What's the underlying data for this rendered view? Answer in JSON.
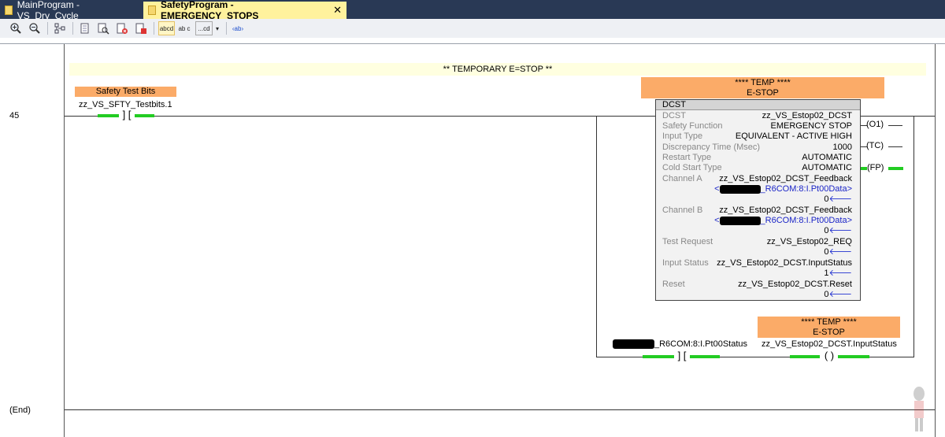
{
  "tabs": [
    {
      "label": "MainProgram - VS_Dry_Cycle",
      "active": false
    },
    {
      "label": "SafetyProgram - EMERGENCY_STOPS",
      "active": true,
      "close": "✕"
    }
  ],
  "toolbar": {
    "abcd_label": "abcd",
    "abc_label": "ab c",
    "cd_label": "...cd",
    "ab_label": "‹ab›"
  },
  "rung": {
    "number": "45",
    "comment": "** TEMPORARY E=STOP **",
    "contact1": {
      "description": "Safety Test Bits",
      "tag": "zz_VS_SFTY_Testbits.1"
    },
    "block_desc": {
      "line1": "**** TEMP ****",
      "line2": "E-STOP"
    },
    "block": {
      "title": "DCST",
      "params": [
        {
          "label": "DCST",
          "value": "zz_VS_Estop02_DCST"
        },
        {
          "label": "Safety Function",
          "value": "EMERGENCY STOP"
        },
        {
          "label": "Input Type",
          "value": "EQUIVALENT - ACTIVE HIGH"
        },
        {
          "label": "Discrepancy Time (Msec)",
          "value": "1000"
        },
        {
          "label": "Restart Type",
          "value": "AUTOMATIC"
        },
        {
          "label": "Cold Start Type",
          "value": "AUTOMATIC"
        },
        {
          "label": "Channel A",
          "value": "zz_VS_Estop02_DCST_Feedback",
          "alias": "_R6COM:8:I.Pt00Data>",
          "alias_prefix": "<",
          "state": "0"
        },
        {
          "label": "Channel B",
          "value": "zz_VS_Estop02_DCST_Feedback",
          "alias": "_R6COM:8:I.Pt00Data>",
          "alias_prefix": "<",
          "state": "0"
        },
        {
          "label": "Test Request",
          "value": "zz_VS_Estop02_REQ",
          "state": "0"
        },
        {
          "label": "Input Status",
          "value": "zz_VS_Estop02_DCST.InputStatus",
          "state": "1"
        },
        {
          "label": "Reset",
          "value": "zz_VS_Estop02_DCST.Reset",
          "state": "0"
        }
      ],
      "outputs": [
        "O1",
        "TC",
        "FP"
      ]
    },
    "contact2": {
      "tag": "_R6COM:8:I.Pt00Status"
    },
    "coil": {
      "description_line1": "**** TEMP ****",
      "description_line2": "E-STOP",
      "tag": "zz_VS_Estop02_DCST.InputStatus"
    },
    "end_label": "(End)"
  },
  "colors": {
    "tab_active": "#fff29d",
    "energized": "#22cc22",
    "description": "#fbab68",
    "comment_bg": "#ffffe0"
  }
}
